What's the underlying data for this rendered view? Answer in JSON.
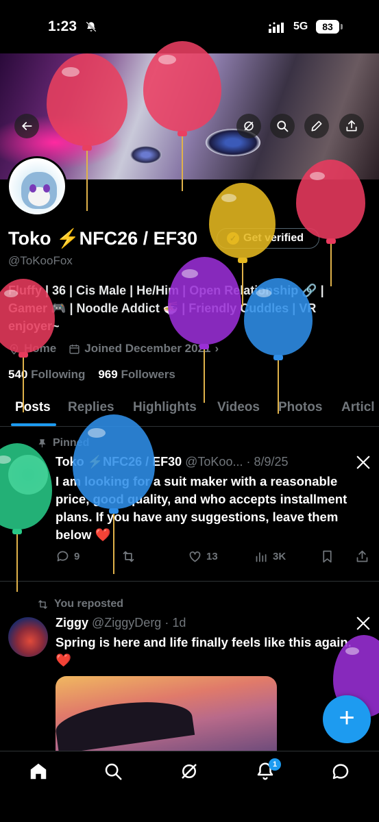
{
  "status_bar": {
    "time": "1:23",
    "network": "5G",
    "battery": "83"
  },
  "profile": {
    "name": "Toko ⚡NFC26 / EF30",
    "verify_label": "Get verified",
    "handle": "@ToKooFox",
    "bio": "Fluffy | 36 | Cis Male | He/Him | Open Relationship 🔗 | Gamer 🎮 | Noodle Addict 🍜 | Friendly Cuddles | VR enjoyer~",
    "location": "Home",
    "joined": "Joined December 2021",
    "following_count": "540",
    "following_label": "Following",
    "followers_count": "969",
    "followers_label": "Followers"
  },
  "tabs": [
    {
      "label": "Posts",
      "active": true
    },
    {
      "label": "Replies"
    },
    {
      "label": "Highlights"
    },
    {
      "label": "Videos"
    },
    {
      "label": "Photos"
    },
    {
      "label": "Articl"
    }
  ],
  "posts": [
    {
      "context": "Pinned",
      "author": "Toko ⚡NFC26 / EF30",
      "handle_date": "@ToKoo... · 8/9/25",
      "text": "I am looking for a suit maker with a reasonable price, good quality, and who accepts installment plans. If you have any suggestions, leave them below ❤️",
      "replies": "9",
      "likes": "13",
      "views": "3K"
    },
    {
      "context": "You reposted",
      "author": "Ziggy",
      "handle_date": "@ZiggyDerg · 1d",
      "text": "Spring is here and life finally feels like this again. ❤️"
    }
  ],
  "fab_label": "+",
  "notifications_badge": "1",
  "colors": {
    "accent": "#1d9bf0",
    "background": "#000000",
    "muted": "#71767b",
    "verified_gold": "#e2b719"
  },
  "icons": [
    "back-arrow-icon",
    "grok-icon",
    "search-icon",
    "edit-icon",
    "share-icon",
    "pin-icon",
    "repost-icon",
    "reply-icon",
    "like-icon",
    "views-icon",
    "bookmark-icon",
    "home-icon",
    "notifications-icon",
    "messages-icon",
    "x-logo-icon"
  ]
}
